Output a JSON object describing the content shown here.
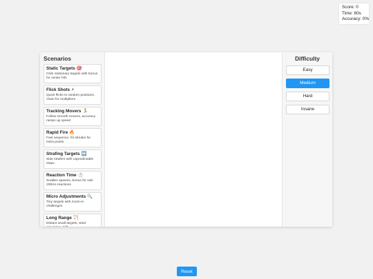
{
  "stats": {
    "score": "Score: 0",
    "time": "Time: 60s",
    "accuracy": "Accuracy: 0%"
  },
  "sidebar": {
    "title": "Scenarios",
    "items": [
      {
        "label": "Static Targets",
        "icon": "🎯",
        "icon_name": "target-icon",
        "desc": "Click stationary targets with bonus for center hits"
      },
      {
        "label": "Flick Shots",
        "icon": "⚡",
        "icon_name": "lightning-icon",
        "desc": "Quick flicks to random positions, chain for multipliers"
      },
      {
        "label": "Tracking Movers",
        "icon": "🏃",
        "icon_name": "runner-icon",
        "desc": "Follow smooth movers, accuracy ramps up speed"
      },
      {
        "label": "Rapid Fire",
        "icon": "🔥",
        "icon_name": "fire-icon",
        "desc": "Fast sequence, hit streaks for extra points"
      },
      {
        "label": "Strafing Targets",
        "icon": "↔️",
        "icon_name": "left-right-arrow-icon",
        "desc": "Side strafers with unpredictable stops"
      },
      {
        "label": "Reaction Time",
        "icon": "⏱️",
        "icon_name": "stopwatch-icon",
        "desc": "Sudden spawns, bonus for sub-200ms reactions"
      },
      {
        "label": "Micro Adjustments",
        "icon": "🔍",
        "icon_name": "magnifier-icon",
        "desc": "Tiny targets with zoom-in challenges"
      },
      {
        "label": "Long Range",
        "icon": "🏹",
        "icon_name": "bow-icon",
        "desc": "Distant small targets, wind simulation drift"
      }
    ]
  },
  "difficulty": {
    "title": "Difficulty",
    "options": [
      "Easy",
      "Medium",
      "Hard",
      "Insane"
    ],
    "selected": "Medium"
  },
  "reset_label": "Reset",
  "colors": {
    "accent": "#2196f3",
    "background": "#f1f1f1",
    "panel": "#ffffff"
  }
}
